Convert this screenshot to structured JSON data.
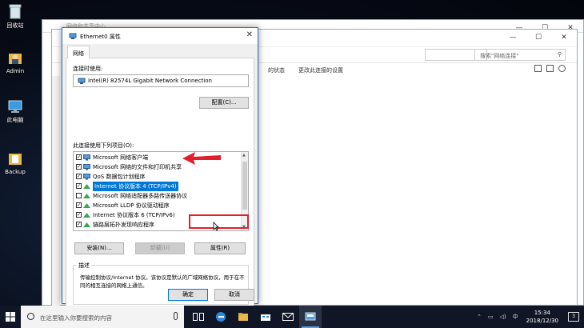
{
  "desktop": {
    "icons": [
      {
        "label": "回收站",
        "icon": "recycle-bin-icon"
      },
      {
        "label": "Admin",
        "icon": "user-folder-icon"
      },
      {
        "label": "此电脑",
        "icon": "computer-icon"
      },
      {
        "label": "Backup",
        "icon": "folder-icon"
      }
    ]
  },
  "explorer_back": {
    "title": "网络和共享中心"
  },
  "explorer_front": {
    "search_placeholder": "搜索\"网络连接\"",
    "cmd_items": [
      "的状态",
      "更改此连接的设置"
    ],
    "window_controls": [
      "—",
      "☐",
      "✕"
    ]
  },
  "dialog": {
    "title": "Ethernet0 属性",
    "tab": "网络",
    "connect_using_label": "连接时使用:",
    "adapter": "Intel(R) 82574L Gigabit Network Connection",
    "configure_button": "配置(C)...",
    "items_label": "此连接使用下列项目(O):",
    "items": [
      {
        "label": "Microsoft 网络客户端",
        "checked": true
      },
      {
        "label": "Microsoft 网络的文件和打印机共享",
        "checked": true
      },
      {
        "label": "QoS 数据包计划程序",
        "checked": true
      },
      {
        "label": "Internet 协议版本 4 (TCP/IPv4)",
        "checked": true,
        "selected": true
      },
      {
        "label": "Microsoft 网络适配器多路传送器协议",
        "checked": false
      },
      {
        "label": "Microsoft LLDP 协议驱动程序",
        "checked": true
      },
      {
        "label": "Internet 协议版本 6 (TCP/IPv6)",
        "checked": true
      },
      {
        "label": "链路层拓扑发现响应程序",
        "checked": true
      }
    ],
    "install_button": "安装(N)...",
    "uninstall_button": "卸载(U)",
    "properties_button": "属性(R)",
    "description_title": "描述",
    "description_text": "传输控制协议/Internet 协议。该协议是默认的广域网络协议，用于在不同的相互连接的网络上通信。",
    "ok_button": "确定",
    "cancel_button": "取消"
  },
  "taskbar": {
    "search_placeholder": "在这里输入你要搜索的内容",
    "time": "15:34",
    "date": "2018/12/30",
    "ime": "中",
    "notification_count": "3"
  },
  "colors": {
    "selection": "#0078d7",
    "highlight": "#e0202a",
    "taskbar": "#101626"
  }
}
